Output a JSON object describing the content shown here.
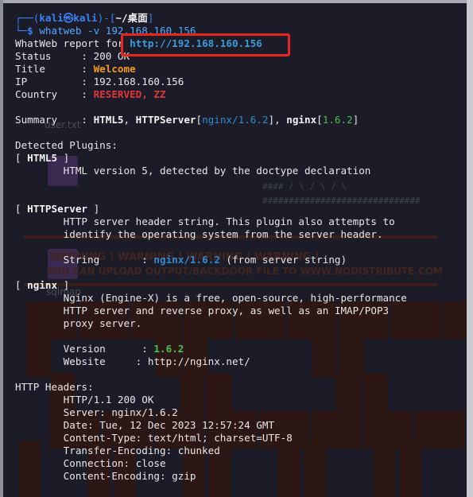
{
  "prompt": {
    "user": "kali",
    "host": "kali",
    "cwd": "~/桌面",
    "command": "whatweb -v 192.168.160.156"
  },
  "report": {
    "header_label": "WhatWeb report for",
    "header_url": "http://192.168.160.156",
    "status_label": "Status",
    "status_value": "200 OK",
    "title_label": "Title",
    "title_value": "Welcome",
    "ip_label": "IP",
    "ip_value": "192.168.160.156",
    "country_label": "Country",
    "country_value": "RESERVED, ZZ",
    "summary_label": "Summary",
    "summary_html5": "HTML5",
    "summary_httpserver": "HTTPServer",
    "summary_httpserver_val": "nginx/1.6.2",
    "summary_nginx": "nginx",
    "summary_nginx_val": "1.6.2"
  },
  "plugins": {
    "heading": "Detected Plugins:",
    "html5": {
      "name": "HTML5",
      "desc": "HTML version 5, detected by the doctype declaration"
    },
    "httpserver": {
      "name": "HTTPServer",
      "desc1": "HTTP server header string. This plugin also attempts to",
      "desc2": "identify the operating system from the server header.",
      "string_label": "String",
      "string_value": "nginx/1.6.2",
      "string_note": "(from server string)"
    },
    "nginx": {
      "name": "nginx",
      "desc1": "Nginx (Engine-X) is a free, open-source, high-performance",
      "desc2": "HTTP server and reverse proxy, as well as an IMAP/POP3",
      "desc3": "proxy server.",
      "version_label": "Version",
      "version_value": "1.6.2",
      "website_label": "Website",
      "website_value": "http://nginx.net/"
    }
  },
  "headers": {
    "heading": "HTTP Headers:",
    "lines": [
      "HTTP/1.1 200 OK",
      "Server: nginx/1.6.2",
      "Date: Tue, 12 Dec 2023 12:57:24 GMT",
      "Content-Type: text/html; charset=UTF-8",
      "Transfer-Encoding: chunked",
      "Connection: close",
      "Content-Encoding: gzip"
    ]
  },
  "background": {
    "file1": "user.txt",
    "file2": "sqlmap",
    "warning1": "WARNING !  WARNING ! WARNING ! WARNING !",
    "warning2": "YOU CAN UPLOAD OUTPUT/BACKDOOR FILE TO WWW.NODISTRIBUTE.COM",
    "hashes1": "####  / \\ / \\ / \\",
    "hashes2": "##############################"
  },
  "colors": {
    "terminal_bg": "#1b1c27",
    "highlight_border": "#e8261d",
    "prompt": "#3b82f6",
    "title_value": "#f39a1e",
    "country_value": "#e1353a",
    "plugin_value": "#2f8bd0",
    "version_value": "#4cbf4c"
  }
}
